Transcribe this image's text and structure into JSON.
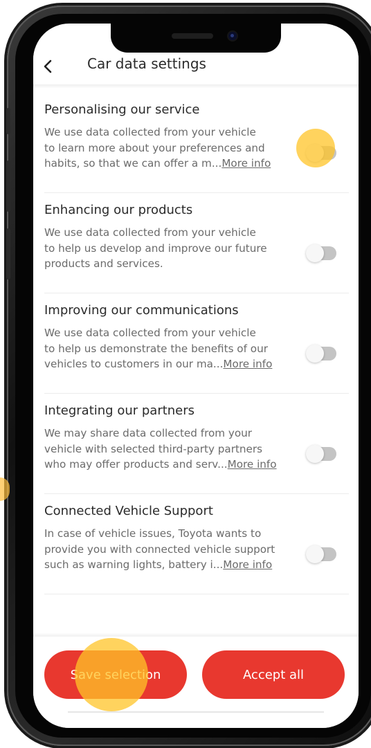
{
  "header": {
    "title": "Car data settings",
    "back_icon": "chevron-left-icon"
  },
  "settings": [
    {
      "title": "Personalising our service",
      "desc_lines": [
        "We use data collected from your vehicle",
        "to learn more about your preferences and"
      ],
      "desc_last": "habits, so that we can offer a m...",
      "more_info": "More info",
      "enabled": false
    },
    {
      "title": "Enhancing our products",
      "desc_lines": [
        "We use data collected from your vehicle",
        "to help us develop and improve our future"
      ],
      "desc_last": "products and services.",
      "more_info": "",
      "enabled": false
    },
    {
      "title": "Improving our communications",
      "desc_lines": [
        "We use data collected from your vehicle",
        "to help us demonstrate the benefits of our"
      ],
      "desc_last": "vehicles to customers in our ma...",
      "more_info": "More info",
      "enabled": false
    },
    {
      "title": "Integrating our partners",
      "desc_lines": [
        "We may share data collected from your",
        "vehicle with selected third-party partners"
      ],
      "desc_last": "who may offer products and serv...",
      "more_info": "More info",
      "enabled": false
    },
    {
      "title": "Connected Vehicle Support",
      "desc_lines": [
        "In case of vehicle issues, Toyota wants to",
        "provide you with connected vehicle support"
      ],
      "desc_last": "such as warning lights, battery i...",
      "more_info": "More info",
      "enabled": false
    }
  ],
  "footer": {
    "save_label": "Save selection",
    "accept_label": "Accept all"
  },
  "colors": {
    "accent": "#e8382f",
    "toggle_off": "#c4c4c4",
    "highlight": "#ffc428"
  }
}
